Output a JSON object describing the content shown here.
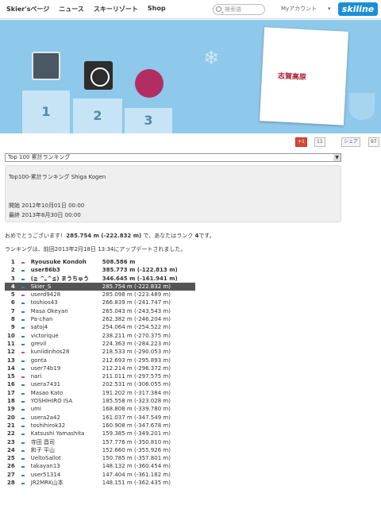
{
  "nav": {
    "links": [
      "Skier'sページ",
      "ニュース",
      "スキーリゾート",
      "Shop"
    ],
    "search_placeholder": "検索語",
    "account": "Myアカウント",
    "caret": "▾",
    "logo": "skiline"
  },
  "hero": {
    "podium": [
      "1",
      "2",
      "3"
    ],
    "card_text": "志賀高原"
  },
  "social": {
    "gplus": "+1",
    "gplus_count": "11",
    "fb": "シェア",
    "fb_count": "97"
  },
  "select": {
    "value": "Top 100 累計ランキング"
  },
  "info": {
    "title": "Top100-累計ランキング Shiga Kogen",
    "start": "開始 2012年10月01日 00:00",
    "end": "最終 2013年8月30日 00:00"
  },
  "congrats": {
    "pre": "おめでとうございます!",
    "value": "285.754 m (-222.832 m)",
    "mid": "で、あなたはランク",
    "rank": "4",
    "post": "です。"
  },
  "updated": "ランキングは、前回2013年2月18日 13:34にアップデートされました。",
  "rows": [
    {
      "rank": "1",
      "name": "Ryousuke Kondoh",
      "score": "508.586 m",
      "bold": true,
      "col": "pk"
    },
    {
      "rank": "2",
      "name": "user86b3",
      "score": "385.773 m (-122.813 m)",
      "bold": true,
      "col": "bl"
    },
    {
      "rank": "3",
      "name": "(≧ ^｡^≦) まうちゅう",
      "score": "346.645 m (-161.941 m)",
      "bold": true,
      "col": "bl"
    },
    {
      "rank": "4",
      "name": "Skier_S",
      "score": "285.754 m (-222.832 m)",
      "hl": true,
      "col": "bl"
    },
    {
      "rank": "5",
      "name": "userd9428",
      "score": "285.098 m (-223.489 m)",
      "col": "pk"
    },
    {
      "rank": "6",
      "name": "toshios43",
      "score": "266.839 m (-241.747 m)",
      "col": "bl"
    },
    {
      "rank": "7",
      "name": "Masa Okeyan",
      "score": "265.043 m (-243.543 m)",
      "col": "bl"
    },
    {
      "rank": "8",
      "name": "Pa-chan",
      "score": "262.382 m (-246.204 m)",
      "col": "bl"
    },
    {
      "rank": "9",
      "name": "satoj4",
      "score": "254.064 m (-254.522 m)",
      "col": "bl"
    },
    {
      "rank": "10",
      "name": "victorique",
      "score": "238.211 m (-270.375 m)",
      "col": "bl"
    },
    {
      "rank": "11",
      "name": "grevil",
      "score": "224.363 m (-284.223 m)",
      "col": "bl"
    },
    {
      "rank": "12",
      "name": "kuniidinhos28",
      "score": "218.533 m (-290.053 m)",
      "col": "pk"
    },
    {
      "rank": "13",
      "name": "gonta",
      "score": "212.693 m (-295.893 m)",
      "col": "bl"
    },
    {
      "rank": "14",
      "name": "user74b19",
      "score": "212.214 m (-296.372 m)",
      "col": "bl"
    },
    {
      "rank": "15",
      "name": "nari",
      "score": "211.011 m (-297.575 m)",
      "col": "pk"
    },
    {
      "rank": "16",
      "name": "usera7431",
      "score": "202.531 m (-306.055 m)",
      "col": "bl"
    },
    {
      "rank": "17",
      "name": "Masao Kato",
      "score": "191.202 m (-317.384 m)",
      "col": "bl"
    },
    {
      "rank": "18",
      "name": "YOSHIHIRO ISA",
      "score": "185.558 m (-323.028 m)",
      "col": "bl"
    },
    {
      "rank": "19",
      "name": "umi",
      "score": "168.808 m (-339.780 m)",
      "col": "bl"
    },
    {
      "rank": "20",
      "name": "usera2a42",
      "score": "161.037 m (-347.549 m)",
      "col": "bl"
    },
    {
      "rank": "21",
      "name": "toshihirok32",
      "score": "160.908 m (-347.678 m)",
      "col": "bl"
    },
    {
      "rank": "22",
      "name": "Katsushi Yamashita",
      "score": "159.385 m (-349.201 m)",
      "col": "bl"
    },
    {
      "rank": "23",
      "name": "寺田 昌司",
      "score": "157.776 m (-350.810 m)",
      "col": "bl"
    },
    {
      "rank": "24",
      "name": "和子 平山",
      "score": "152.660 m (-355.926 m)",
      "col": "bl"
    },
    {
      "rank": "25",
      "name": "UeltoSallot",
      "score": "150.785 m (-357.801 m)",
      "col": "bl"
    },
    {
      "rank": "26",
      "name": "takayan13",
      "score": "148.132 m (-360.454 m)",
      "col": "bl"
    },
    {
      "rank": "27",
      "name": "user51314",
      "score": "147.404 m (-361.182 m)",
      "col": "bl"
    },
    {
      "rank": "28",
      "name": "JR2MRK山本",
      "score": "148.151 m (-362.435 m)",
      "col": "bl"
    }
  ]
}
